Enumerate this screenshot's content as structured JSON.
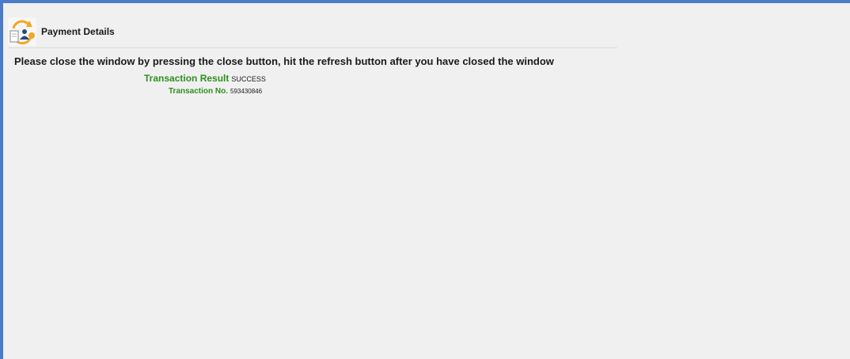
{
  "header": {
    "title": "Payment Details",
    "icon": "payment-refresh-icon"
  },
  "message": "Please close the window by pressing the close button, hit the refresh button after you have closed the window",
  "transaction": {
    "result_label": "Transaction Result",
    "result_value": "SUCCESS",
    "number_label": "Transaction No.",
    "number_value": "593430846"
  },
  "colors": {
    "frame": "#4a7cc7",
    "background": "#f0f0f1",
    "label_green": "#2f8f1e",
    "icon_orange": "#f5a623"
  }
}
